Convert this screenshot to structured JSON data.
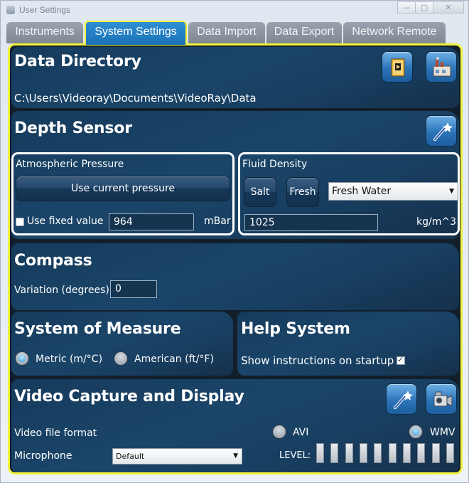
{
  "window": {
    "title": "User Settings",
    "minimize": "—",
    "maximize": "▢",
    "close": "✕"
  },
  "tabs": [
    {
      "label": "Instruments"
    },
    {
      "label": "System Settings"
    },
    {
      "label": "Data Import"
    },
    {
      "label": "Data Export"
    },
    {
      "label": "Network Remote"
    }
  ],
  "data_directory": {
    "title": "Data Directory",
    "path": "C:\\Users\\Videoray\\Documents\\VideoRay\\Data"
  },
  "depth_sensor": {
    "title": "Depth Sensor",
    "atmospheric_pressure": {
      "label": "Atmospheric Pressure",
      "use_current_label": "Use current pressure",
      "use_fixed_label": "Use fixed value",
      "use_fixed_checked": false,
      "value": "964",
      "unit": "mBar"
    },
    "fluid_density": {
      "label": "Fluid Density",
      "salt_label": "Salt",
      "fresh_label": "Fresh",
      "selected": "Fresh Water",
      "value": "1025",
      "unit": "kg/m^3"
    }
  },
  "compass": {
    "title": "Compass",
    "variation_label": "Variation (degrees)",
    "variation_value": "0"
  },
  "system_of_measure": {
    "title": "System of Measure",
    "metric_label": "Metric (m/°C)",
    "american_label": "American (ft/°F)",
    "selected": "metric"
  },
  "help_system": {
    "title": "Help System",
    "show_instructions_label": "Show instructions on startup",
    "show_instructions_checked": true
  },
  "video": {
    "title": "Video Capture and Display",
    "file_format_label": "Video file format",
    "avi_label": "AVI",
    "wmv_label": "WMV",
    "selected_format": "wmv",
    "microphone_label": "Microphone",
    "microphone_selected": "Default",
    "level_label": "LEVEL:"
  },
  "colors": {
    "accent_yellow": "#eef23c",
    "active_tab": "#1f78bd",
    "panel_blue": "#1a4569"
  }
}
